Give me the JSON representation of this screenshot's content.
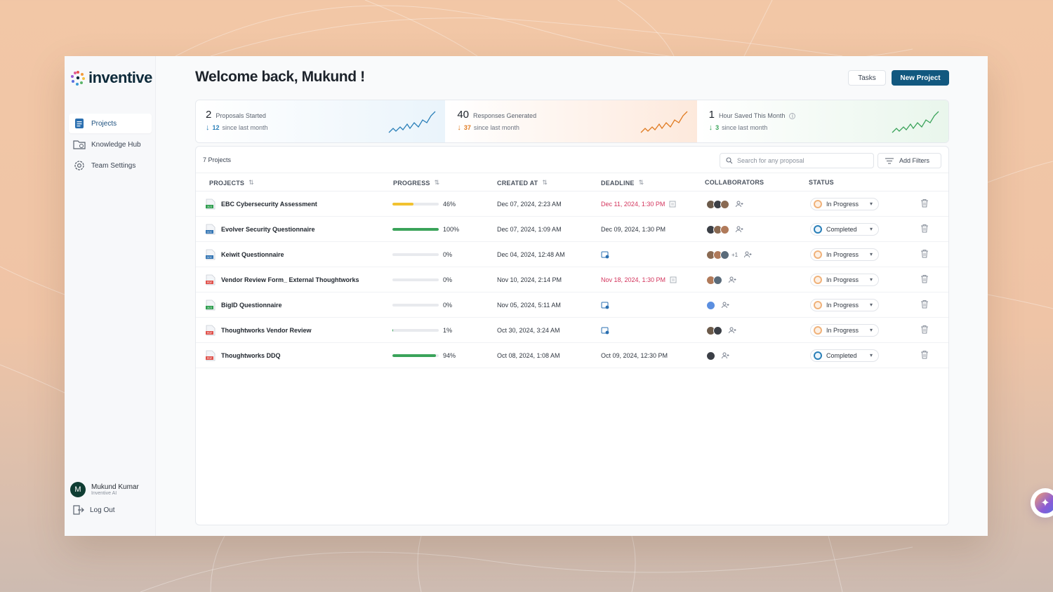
{
  "brand": {
    "name": "inventive"
  },
  "sidebar": {
    "items": [
      {
        "label": "Projects",
        "icon": "document-icon",
        "active": true
      },
      {
        "label": "Knowledge Hub",
        "icon": "folder-icon",
        "active": false
      },
      {
        "label": "Team Settings",
        "icon": "gear-icon",
        "active": false
      }
    ],
    "user": {
      "initial": "M",
      "name": "Mukund Kumar",
      "org": "Inventive AI"
    },
    "logout_label": "Log Out"
  },
  "header": {
    "welcome": "Welcome back, Mukund !",
    "tasks_label": "Tasks",
    "new_project_label": "New Project"
  },
  "stats": [
    {
      "value": "2",
      "label": "Proposals Started",
      "delta": "12",
      "since": "since last month",
      "color": "#2a7fb8"
    },
    {
      "value": "40",
      "label": "Responses Generated",
      "delta": "37",
      "since": "since last month",
      "color": "#e07a1f"
    },
    {
      "value": "1",
      "label": "Hour Saved This Month",
      "delta": "3",
      "since": "since last month",
      "color": "#3aa35a"
    }
  ],
  "table": {
    "count_label": "7 Projects",
    "search_placeholder": "Search for any proposal",
    "filters_label": "Add Filters",
    "headers": {
      "projects": "PROJECTS",
      "progress": "PROGRESS",
      "created": "CREATED AT",
      "deadline": "DEADLINE",
      "collaborators": "COLLABORATORS",
      "status": "STATUS"
    },
    "rows": [
      {
        "type": "XLS",
        "name": "EBC Cybersecurity Assessment",
        "progress": 46,
        "progress_label": "46%",
        "bar_color": "#f2c230",
        "created": "Dec 07, 2024, 2:23 AM",
        "deadline": "Dec 11, 2024, 1:30 PM",
        "overdue": true,
        "collab_more": "",
        "status": "In Progress"
      },
      {
        "type": "DOC",
        "name": "Evolver Security Questionnaire",
        "progress": 100,
        "progress_label": "100%",
        "bar_color": "#3aa35a",
        "created": "Dec 07, 2024, 1:09 AM",
        "deadline": "Dec 09, 2024, 1:30 PM",
        "overdue": false,
        "collab_more": "",
        "status": "Completed"
      },
      {
        "type": "DOC",
        "name": "Keiwit Questionnaire",
        "progress": 0,
        "progress_label": "0%",
        "bar_color": "#3aa35a",
        "created": "Dec 04, 2024, 12:48 AM",
        "deadline": "",
        "overdue": false,
        "collab_more": "+1",
        "status": "In Progress"
      },
      {
        "type": "PDF",
        "name": "Vendor Review Form_ External Thoughtworks",
        "progress": 0,
        "progress_label": "0%",
        "bar_color": "#3aa35a",
        "created": "Nov 10, 2024, 2:14 PM",
        "deadline": "Nov 18, 2024, 1:30 PM",
        "overdue": true,
        "collab_more": "",
        "status": "In Progress"
      },
      {
        "type": "XLS",
        "name": "BigID Questionnaire",
        "progress": 0,
        "progress_label": "0%",
        "bar_color": "#3aa35a",
        "created": "Nov 05, 2024, 5:11 AM",
        "deadline": "",
        "overdue": false,
        "collab_more": "",
        "status": "In Progress"
      },
      {
        "type": "PDF",
        "name": "Thoughtworks Vendor Review",
        "progress": 1,
        "progress_label": "1%",
        "bar_color": "#3aa35a",
        "created": "Oct 30, 2024, 3:24 AM",
        "deadline": "",
        "overdue": false,
        "collab_more": "",
        "status": "In Progress"
      },
      {
        "type": "PDF",
        "name": "Thoughtworks DDQ",
        "progress": 94,
        "progress_label": "94%",
        "bar_color": "#3aa35a",
        "created": "Oct 08, 2024, 1:08 AM",
        "deadline": "Oct 09, 2024, 12:30 PM",
        "overdue": false,
        "collab_more": "",
        "status": "Completed"
      }
    ]
  },
  "colors": {
    "accent": "#12587f",
    "overdue": "#d3345c",
    "in_progress": "#f0b27a",
    "completed": "#2a7fb8"
  }
}
